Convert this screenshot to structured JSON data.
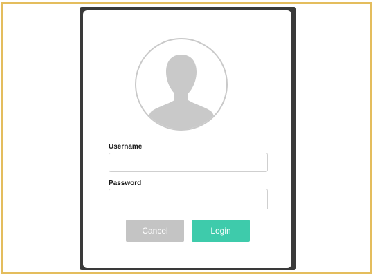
{
  "login_dialog": {
    "avatar_icon": "user-silhouette-icon",
    "username": {
      "label": "Username",
      "value": "",
      "placeholder": ""
    },
    "password": {
      "label": "Password",
      "value": "",
      "placeholder": ""
    },
    "cancel_label": "Cancel",
    "login_label": "Login"
  },
  "colors": {
    "frame_border": "#e4bd5d",
    "dialog_bezel": "#3a3a3a",
    "cancel_button": "#c4c4c4",
    "login_button": "#3ecbab",
    "avatar_fill": "#c9c9c9"
  }
}
